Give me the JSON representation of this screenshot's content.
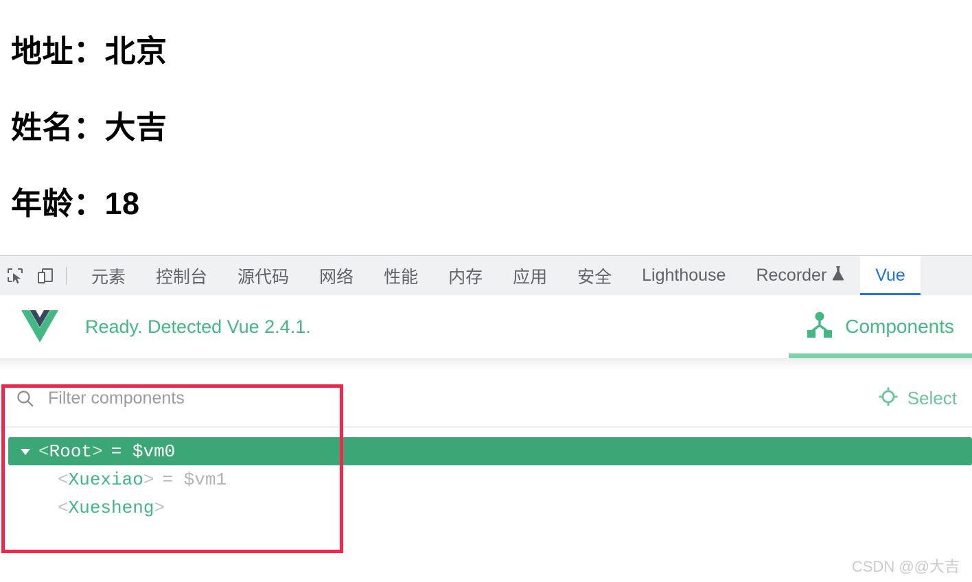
{
  "page": {
    "lines": [
      {
        "label": "地址：",
        "value": "北京"
      },
      {
        "label": "姓名：",
        "value": "大吉"
      },
      {
        "label": "年龄：",
        "value": "18"
      }
    ],
    "line1_full": "地址：北京",
    "line2_full": "姓名：大吉",
    "line3_full": "年龄：18"
  },
  "devtools": {
    "toolbar_icons": [
      {
        "name": "inspect-element-icon"
      },
      {
        "name": "device-toolbar-icon"
      }
    ],
    "tabs": [
      {
        "label": "元素",
        "active": false
      },
      {
        "label": "控制台",
        "active": false
      },
      {
        "label": "源代码",
        "active": false
      },
      {
        "label": "网络",
        "active": false
      },
      {
        "label": "性能",
        "active": false
      },
      {
        "label": "内存",
        "active": false
      },
      {
        "label": "应用",
        "active": false
      },
      {
        "label": "安全",
        "active": false
      },
      {
        "label": "Lighthouse",
        "active": false
      },
      {
        "label": "Recorder",
        "active": false,
        "icon": "flask-icon"
      },
      {
        "label": "Vue",
        "active": true
      }
    ],
    "active_tab": "Vue",
    "active_tab_color": "#1a73e8"
  },
  "vue_devtools": {
    "logo_name": "vue-logo",
    "status_text": "Ready. Detected Vue 2.4.1.",
    "status_color": "#42b983",
    "panel_tabs": [
      {
        "label": "Components",
        "icon": "components-tree-icon",
        "active": true
      }
    ],
    "accent_color": "#42b983",
    "underline_color": "#7fd1ac"
  },
  "components_panel": {
    "filter": {
      "icon": "search-icon",
      "placeholder": "Filter components",
      "value": ""
    },
    "select_button": {
      "icon": "target-crosshair-icon",
      "label": "Select",
      "color": "#6cc49a"
    },
    "tree": [
      {
        "name": "Root",
        "vm": "$vm0",
        "selected": true,
        "expanded": true,
        "depth": 0,
        "open_bracket": "<",
        "close_bracket": ">",
        "eq": "= "
      },
      {
        "name": "Xuexiao",
        "vm": "$vm1",
        "selected": false,
        "expanded": false,
        "depth": 1,
        "open_bracket": "<",
        "close_bracket": ">",
        "eq": "= "
      },
      {
        "name": "Xuesheng",
        "vm": "",
        "selected": false,
        "expanded": false,
        "depth": 1,
        "open_bracket": "<",
        "close_bracket": ">",
        "eq": ""
      }
    ],
    "selected_row_bg": "#3ba776"
  },
  "annotation": {
    "name": "red-highlight-box",
    "color": "#f5264a"
  },
  "watermark": {
    "text": "CSDN @@大吉",
    "color": "#c9cbcd"
  }
}
